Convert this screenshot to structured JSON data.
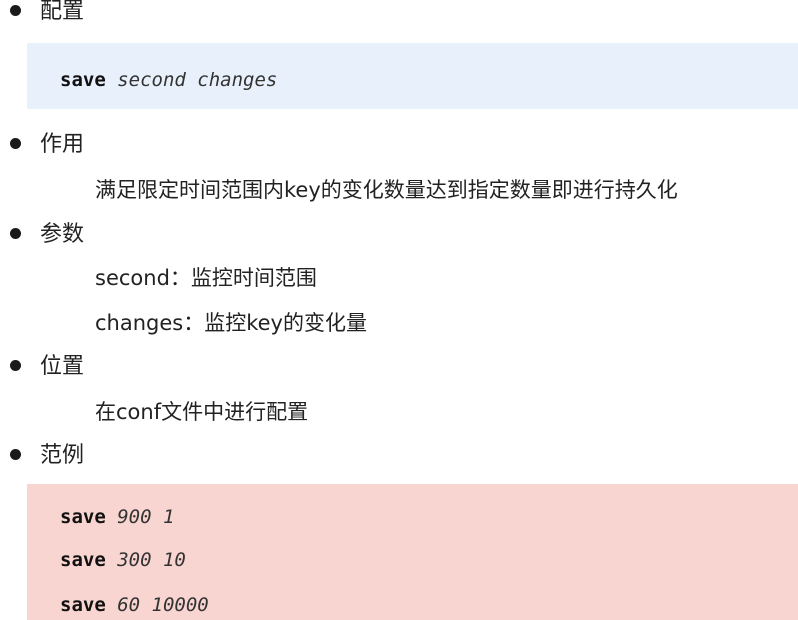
{
  "sections": {
    "config": {
      "title": "配置"
    },
    "purpose": {
      "title": "作用",
      "text": "满足限定时间范围内key的变化数量达到指定数量即进行持久化"
    },
    "params": {
      "title": "参数",
      "items": [
        {
          "text": "second：监控时间范围"
        },
        {
          "text": "changes：监控key的变化量"
        }
      ]
    },
    "location": {
      "title": "位置",
      "text": "在conf文件中进行配置"
    },
    "examples": {
      "title": "范例"
    }
  },
  "config_code": {
    "keyword": "save",
    "args": "second changes"
  },
  "example_code": [
    {
      "keyword": "save",
      "args": "900 1"
    },
    {
      "keyword": "save",
      "args": "300 10"
    },
    {
      "keyword": "save",
      "args": "60 10000"
    }
  ],
  "colors": {
    "config_box": "#e8f1fb",
    "example_box": "#f9d5d2",
    "text": "#222222"
  }
}
